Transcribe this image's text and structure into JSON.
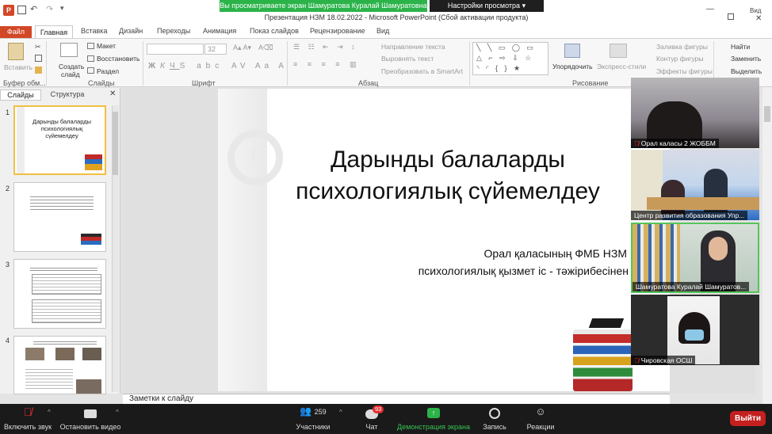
{
  "titlebar": {
    "share_banner": "Вы просматриваете экран Шамуратова Куралай Шамуратовна",
    "view_settings": "Настройки просмотра",
    "window_title": "Презентация НЗМ 18.02.2022 - Microsoft PowerPoint (Сбой активации продукта)",
    "top_right": "Вид"
  },
  "tabs": [
    "Файл",
    "Главная",
    "Вставка",
    "Дизайн",
    "Переходы",
    "Анимация",
    "Показ слайдов",
    "Рецензирование",
    "Вид"
  ],
  "ribbon": {
    "paste": "Вставить",
    "clipboard": "Буфер обм...",
    "create_slide": "Создать",
    "create_slide2": "слайд",
    "layout": "Макет",
    "restore": "Восстановить",
    "section": "Раздел",
    "slides_group": "Слайды",
    "font_size": "32",
    "font_group": "Шрифт",
    "text_direction": "Направление текста",
    "align_text": "Выровнять текст",
    "smartart": "Преобразовать в SmartArt",
    "paragraph_group": "Абзац",
    "arrange": "Упорядочить",
    "quick_styles": "Экспресс-стили",
    "shape_fill": "Заливка фигуры",
    "shape_outline": "Контур фигуры",
    "shape_effects": "Эффекты фигуры",
    "drawing_group": "Рисование",
    "find": "Найти",
    "replace": "Заменить",
    "select": "Выделить"
  },
  "slides_panel": {
    "tab_slides": "Слайды",
    "tab_structure": "Структура",
    "numbers": [
      "1",
      "2",
      "3",
      "4"
    ],
    "thumb1_title": "Дарынды балаларды психологиялық сүйемелдеу"
  },
  "slide": {
    "title": "Дарынды балаларды психологиялық сүйемелдеу",
    "line1": "Орал қаласының ФМБ НЗМ",
    "line2": "психологиялық қызмет іс - тәжірибесінен"
  },
  "notes": "Заметки к слайду",
  "participants": [
    "Орал каласы 2 ЖОББМ",
    "Центр развития образования Упр...",
    "Шамуратова Куралай Шамуратов...",
    "Чировская ОСШ"
  ],
  "zoom": {
    "mute": "Включить звук",
    "video": "Остановить видео",
    "participants_count": "259",
    "participants": "Участники",
    "chat_badge": "93",
    "chat": "Чат",
    "share": "Демонстрация экрана",
    "record": "Запись",
    "reactions": "Реакции",
    "leave": "Выйти"
  },
  "colors": {
    "file_tab": "#d24726",
    "share_green": "#2bb34a",
    "leave_red": "#c4201f",
    "zoom_bar": "#1a1a1a"
  }
}
